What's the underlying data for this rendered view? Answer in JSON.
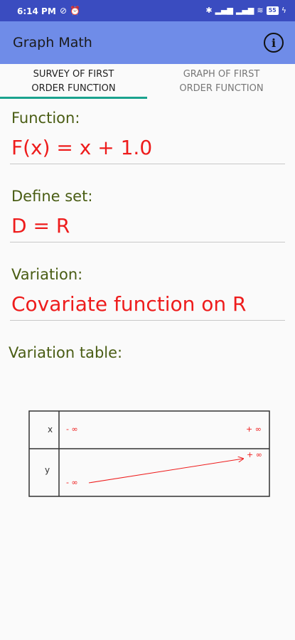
{
  "status_bar": {
    "time": "6:14 PM",
    "battery": "55"
  },
  "app_bar": {
    "title": "Graph Math"
  },
  "tabs": [
    {
      "line1": "SURVEY OF FIRST",
      "line2": "ORDER FUNCTION"
    },
    {
      "line1": "GRAPH OF FIRST",
      "line2": "ORDER FUNCTION"
    }
  ],
  "function": {
    "label": "Function:",
    "value": "F(x) = x + 1.0"
  },
  "define_set": {
    "label": "Define set:",
    "value": "D = R"
  },
  "variation": {
    "label": "Variation:",
    "value": "Covariate function on R"
  },
  "variation_table": {
    "label": "Variation table:",
    "row_x_label": "x",
    "row_y_label": "y",
    "x_start": "- ∞",
    "x_end": "+ ∞",
    "y_start": "- ∞",
    "y_end": "+ ∞"
  },
  "colors": {
    "accent": "#ee1c1c",
    "label": "#4a5d14",
    "app_bar": "#6f8ce8",
    "status_bar": "#3a4cc0",
    "tab_indicator": "#1aa38e"
  }
}
